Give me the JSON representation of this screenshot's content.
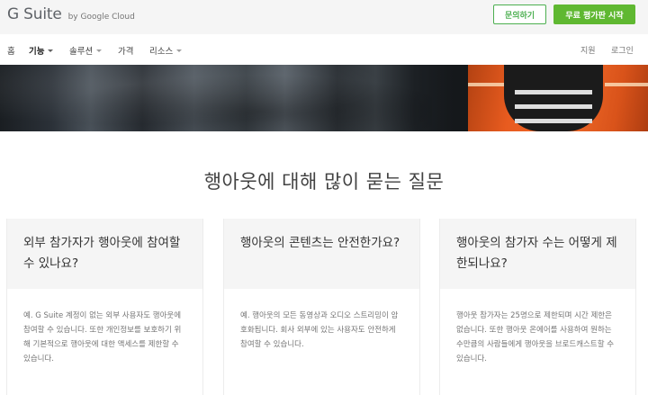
{
  "header": {
    "brand": "G Suite",
    "brand_sub": "by Google Cloud",
    "contact_button": "문의하기",
    "trial_button": "무료 평가판 시작"
  },
  "nav": {
    "items": [
      {
        "label": "홈"
      },
      {
        "label": "기능"
      },
      {
        "label": "솔루션"
      },
      {
        "label": "가격"
      },
      {
        "label": "리소스"
      }
    ],
    "support": "지원",
    "login": "로그인"
  },
  "faq": {
    "title": "행아웃에 대해 많이 묻는 질문",
    "cards": [
      {
        "question": "외부 참가자가 행아웃에 참여할 수 있나요?",
        "answer": "예. G Suite 계정이 없는 외부 사용자도 행아웃에 참여할 수 있습니다. 또한 개인정보를 보호하기 위해 기본적으로 행아웃에 대한 액세스를 제한할 수 있습니다."
      },
      {
        "question": "행아웃의 콘텐츠는 안전한가요?",
        "answer": "예. 행아웃의 모든 동영상과 오디오 스트리밍이 암호화됩니다. 회사 외부에 있는 사용자도 안전하게 참여할 수 있습니다."
      },
      {
        "question": "행아웃의 참가자 수는 어떻게 제한되나요?",
        "answer": "행아웃 참가자는 25명으로 제한되며 시간 제한은 없습니다. 또한 행아웃 온에어를 사용하여 원하는 수만큼의 사람들에게 행아웃을 브로드캐스트할 수 있습니다."
      }
    ]
  }
}
